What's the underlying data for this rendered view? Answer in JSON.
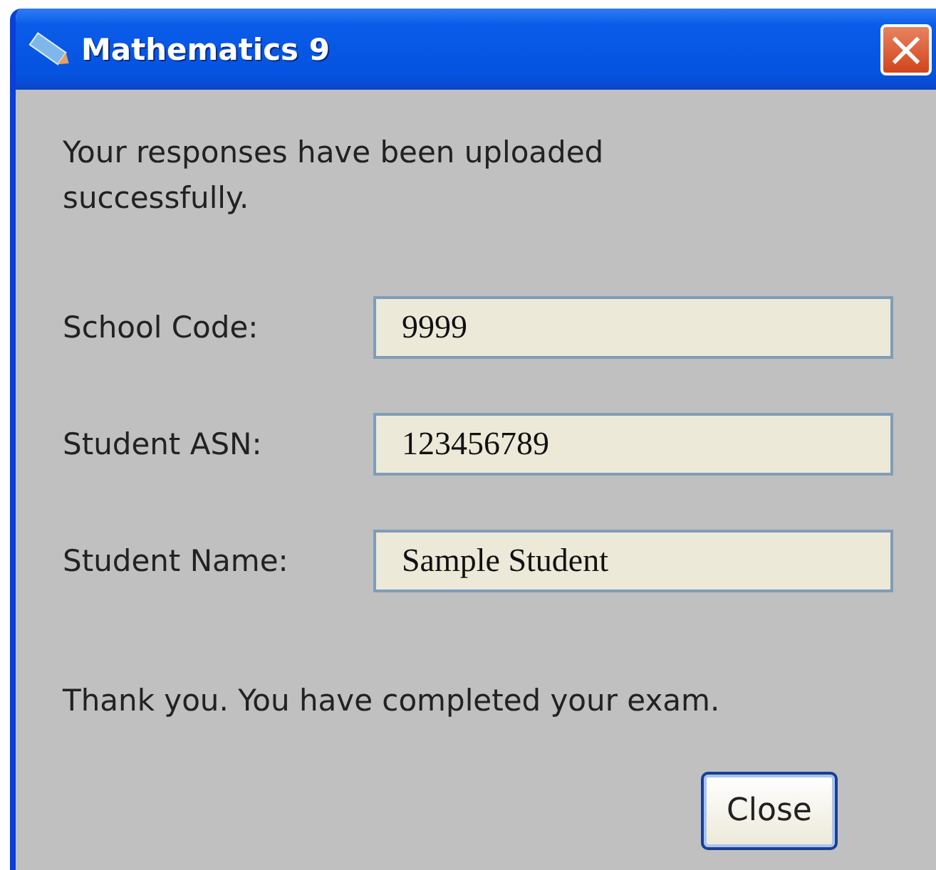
{
  "window": {
    "title": "Mathematics 9",
    "close_glyph": "×"
  },
  "message": "Your responses have been uploaded successfully.",
  "fields": [
    {
      "label": "School Code:",
      "value": "9999"
    },
    {
      "label": "Student ASN:",
      "value": "123456789"
    },
    {
      "label": "Student Name:",
      "value": "Sample Student"
    }
  ],
  "footer": "Thank you. You have completed your exam.",
  "buttons": [
    "Close"
  ]
}
